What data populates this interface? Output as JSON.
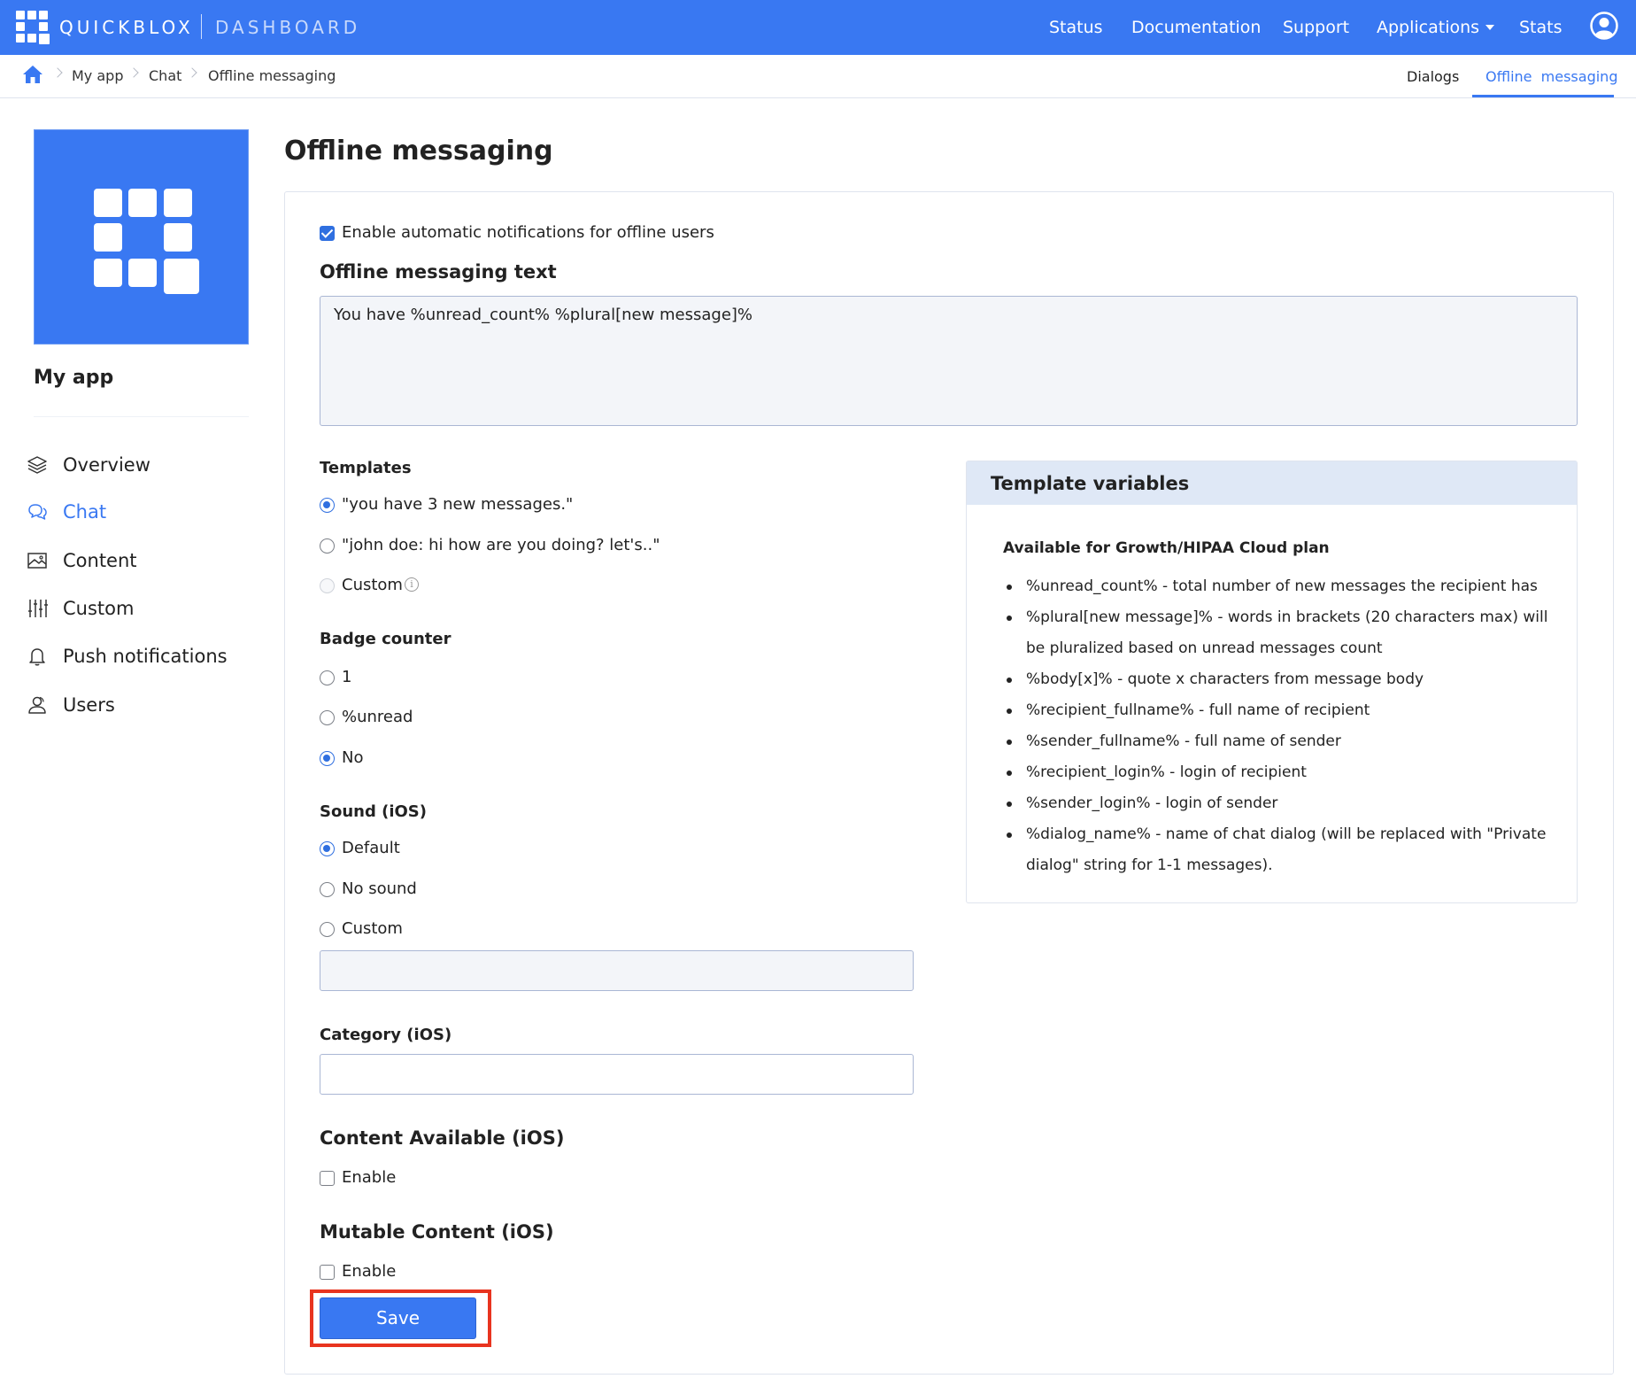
{
  "topbar": {
    "brand": "QUICKBLOX",
    "brand_suffix": "DASHBOARD",
    "nav": {
      "status": "Status",
      "documentation": "Documentation",
      "support": "Support",
      "applications": "Applications",
      "stats": "Stats"
    },
    "accent_color": "#3978f2"
  },
  "breadcrumb": {
    "items": [
      "My app",
      "Chat",
      "Offline messaging"
    ]
  },
  "subtabs": {
    "dialogs": "Dialogs",
    "offline": "Offline  messaging",
    "active": "offline"
  },
  "sidebar": {
    "app_name": "My app",
    "items": [
      {
        "label": "Overview",
        "icon": "layers-icon"
      },
      {
        "label": "Chat",
        "icon": "chat-icon",
        "active": true
      },
      {
        "label": "Content",
        "icon": "image-icon"
      },
      {
        "label": "Custom",
        "icon": "sliders-icon"
      },
      {
        "label": "Push notifications",
        "icon": "bell-icon"
      },
      {
        "label": "Users",
        "icon": "users-icon"
      }
    ]
  },
  "main": {
    "title": "Offline messaging",
    "enable_auto": {
      "label": "Enable automatic notifications for offline users",
      "checked": true
    },
    "text_label": "Offline messaging text",
    "text_value": "You have %unread_count% %plural[new message]%",
    "templates": {
      "label": "Templates",
      "options": [
        {
          "label": "\"you have 3 new messages.\"",
          "selected": true
        },
        {
          "label": "\"john doe: hi how are you doing? let's..\"",
          "selected": false
        },
        {
          "label": "Custom",
          "selected": false,
          "disabled": true
        }
      ]
    },
    "badge": {
      "label": "Badge counter",
      "options": [
        {
          "label": "1",
          "selected": false
        },
        {
          "label": "%unread",
          "selected": false
        },
        {
          "label": "No",
          "selected": true
        }
      ]
    },
    "sound": {
      "label": "Sound (iOS)",
      "options": [
        {
          "label": "Default",
          "selected": true
        },
        {
          "label": "No sound",
          "selected": false
        },
        {
          "label": "Custom",
          "selected": false
        }
      ],
      "custom_value": ""
    },
    "category": {
      "label": "Category (iOS)",
      "value": ""
    },
    "content_available": {
      "label": "Content Available (iOS)",
      "option": "Enable",
      "checked": false
    },
    "mutable_content": {
      "label": "Mutable Content (iOS)",
      "option": "Enable",
      "checked": false
    },
    "save_label": "Save"
  },
  "template_vars": {
    "title": "Template variables",
    "subtitle": "Available for Growth/HIPAA Cloud plan",
    "items": [
      "%unread_count% - total number of new messages the recipient has",
      "%plural[new message]% - words in brackets (20 characters max) will be pluralized based on unread messages count",
      "%body[x]% - quote x characters from message body",
      "%recipient_fullname% - full name of recipient",
      "%sender_fullname% - full name of sender",
      "%recipient_login% - login of recipient",
      "%sender_login% - login of sender",
      "%dialog_name% - name of chat dialog (will be replaced with \"Private dialog\" string for 1-1 messages)."
    ]
  }
}
